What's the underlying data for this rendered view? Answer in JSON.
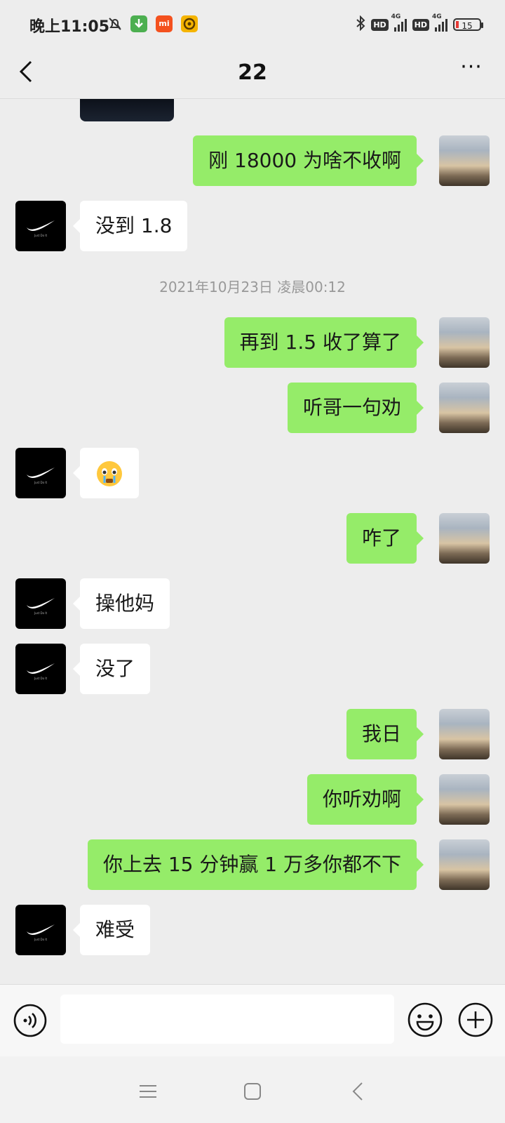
{
  "status_bar": {
    "time": "晚上11:05",
    "hd_label": "HD",
    "network_label": "4G",
    "battery": "15",
    "icons": [
      "mute-bell-icon",
      "download-app-icon",
      "mi-app-icon",
      "game-app-icon",
      "bluetooth-icon",
      "signal-icon",
      "battery-icon"
    ]
  },
  "header": {
    "title": "22",
    "back_icon": "chevron-left-icon",
    "more_icon": "more-dots-icon",
    "more_label": "···"
  },
  "messages": [
    {
      "side": "right",
      "type": "text",
      "text": "刚 18000 为啥不收啊"
    },
    {
      "side": "left",
      "type": "text",
      "text": "没到 1.8"
    },
    {
      "type": "time",
      "text": "2021年10月23日 凌晨00:12"
    },
    {
      "side": "right",
      "type": "text",
      "text": "再到 1.5 收了算了"
    },
    {
      "side": "right",
      "type": "text",
      "text": "听哥一句劝"
    },
    {
      "side": "left",
      "type": "emoji",
      "text": "😭"
    },
    {
      "side": "right",
      "type": "text",
      "text": "咋了"
    },
    {
      "side": "left",
      "type": "text",
      "text": "操他妈"
    },
    {
      "side": "left",
      "type": "text",
      "text": "没了"
    },
    {
      "side": "right",
      "type": "text",
      "text": "我日"
    },
    {
      "side": "right",
      "type": "text",
      "text": "你听劝啊"
    },
    {
      "side": "right",
      "type": "text",
      "text": "你上去 15 分钟赢 1 万多你都不下"
    },
    {
      "side": "left",
      "type": "text",
      "text": "难受"
    }
  ],
  "avatars": {
    "left": "nike-swoosh-avatar",
    "right": "sunset-sky-avatar"
  },
  "input_bar": {
    "placeholder": "",
    "value": "",
    "voice_icon": "voice-icon",
    "emoji_icon": "emoji-icon",
    "plus_icon": "plus-icon"
  },
  "system_nav": {
    "icons": [
      "menu-icon",
      "home-icon",
      "back-icon"
    ]
  },
  "colors": {
    "background": "#ededed",
    "outgoing_bubble": "#95ec69",
    "incoming_bubble": "#ffffff",
    "timestamp": "#999999"
  }
}
